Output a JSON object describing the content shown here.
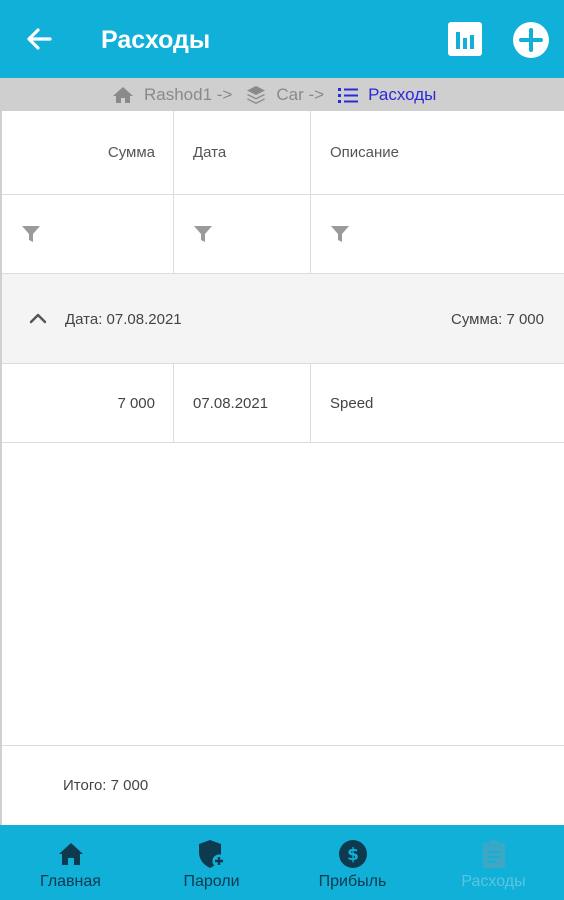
{
  "appbar": {
    "title": "Расходы",
    "back_icon": "arrow-left-icon",
    "chart_icon": "bar-chart-icon",
    "add_icon": "plus-circle-icon"
  },
  "breadcrumb": {
    "items": [
      {
        "label": "Rashod1 ->",
        "icon": "home-icon"
      },
      {
        "label": "Car ->",
        "icon": "layers-icon"
      },
      {
        "label": "Расходы",
        "icon": "list-icon",
        "active": true
      }
    ]
  },
  "table": {
    "headers": [
      "Сумма",
      "Дата",
      "Описание"
    ],
    "filter_icon": "filter-icon",
    "group": {
      "label": "Дата: 07.08.2021",
      "summary": "Сумма: 7 000"
    },
    "rows": [
      {
        "sum": "7 000",
        "date": "07.08.2021",
        "description": "Speed"
      }
    ],
    "total": "Итого: 7 000"
  },
  "bottomnav": {
    "items": [
      {
        "label": "Главная",
        "icon": "home-icon"
      },
      {
        "label": "Пароли",
        "icon": "shield-plus-icon"
      },
      {
        "label": "Прибыль",
        "icon": "dollar-circle-icon"
      },
      {
        "label": "Расходы",
        "icon": "clipboard-icon"
      }
    ]
  },
  "colors": {
    "accent": "#10b0d8",
    "breadcrumb_active": "#2a2bd8",
    "nav_active": "#0d3a4f",
    "nav_inactive": "#5dc4e0"
  }
}
